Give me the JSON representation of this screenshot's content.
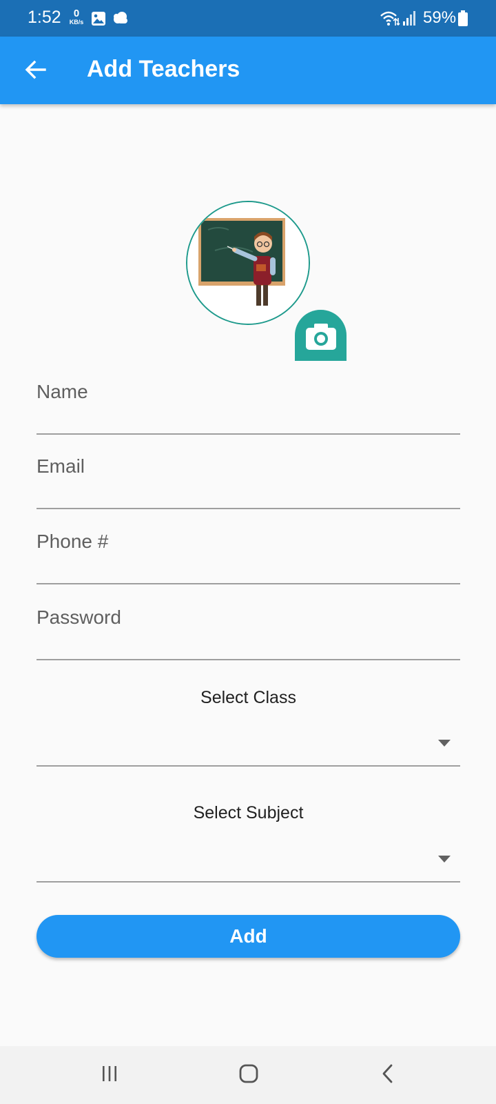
{
  "status_bar": {
    "time": "1:52",
    "net_speed_value": "0",
    "net_speed_unit": "KB/s",
    "battery_percent": "59%",
    "icons": [
      "gallery-icon",
      "cloud-icon",
      "wifi-icon",
      "signal-icon",
      "battery-icon"
    ]
  },
  "app_bar": {
    "title": "Add Teachers",
    "back_icon": "arrow-back-icon",
    "color": "#2196f3"
  },
  "avatar": {
    "description_icon": "teacher-avatar",
    "camera_icon": "camera-icon",
    "accent": "#26a69a"
  },
  "form": {
    "fields": [
      {
        "label": "Name",
        "value": ""
      },
      {
        "label": "Email",
        "value": ""
      },
      {
        "label": "Phone #",
        "value": ""
      },
      {
        "label": "Password",
        "value": ""
      }
    ],
    "dropdowns": [
      {
        "label": "Select Class",
        "value": ""
      },
      {
        "label": "Select Subject",
        "value": ""
      }
    ],
    "submit_label": "Add"
  },
  "nav_bar": {
    "icons": [
      "recent-apps-icon",
      "home-icon",
      "back-nav-icon"
    ]
  }
}
